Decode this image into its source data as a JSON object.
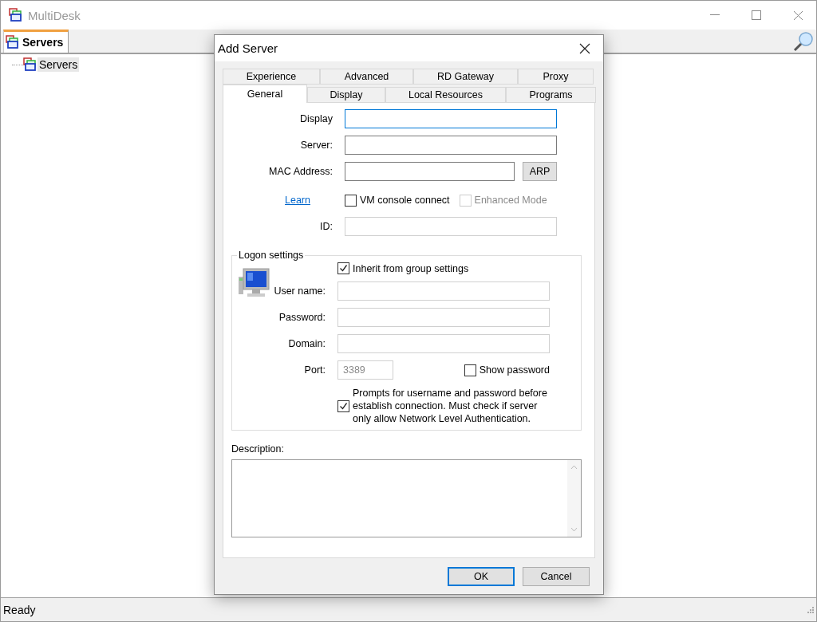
{
  "window": {
    "title": "MultiDesk"
  },
  "tabs": [
    {
      "label": "Servers",
      "selected": true
    }
  ],
  "tree": [
    {
      "label": "Servers",
      "selected": true
    }
  ],
  "status_bar": "Ready",
  "dialog": {
    "title": "Add Server",
    "tab_rows": [
      [
        {
          "label": "Experience",
          "selected": false
        },
        {
          "label": "Advanced",
          "selected": false
        },
        {
          "label": "RD Gateway",
          "selected": false
        },
        {
          "label": "Proxy",
          "selected": false
        }
      ],
      [
        {
          "label": "General",
          "selected": true
        },
        {
          "label": "Display",
          "selected": false
        },
        {
          "label": "Local Resources",
          "selected": false
        },
        {
          "label": "Programs",
          "selected": false
        }
      ]
    ],
    "display": {
      "label": "Display",
      "focused": true
    },
    "server": {
      "label": "Server:"
    },
    "mac": {
      "label": "MAC Address:",
      "button": "ARP"
    },
    "learn_link": "Learn",
    "vm_console": {
      "label": "VM console connect",
      "checked": false,
      "disabled": false
    },
    "enhanced_mode": {
      "label": "Enhanced Mode",
      "checked": false,
      "disabled": true
    },
    "id": {
      "label": "ID:",
      "disabled": true
    },
    "logon": {
      "title": "Logon settings",
      "inherit": {
        "label": "Inherit from group settings",
        "checked": true,
        "disabled": false
      },
      "fields": [
        {
          "label": "User name:",
          "disabled": true
        },
        {
          "label": "Password:",
          "disabled": true
        },
        {
          "label": "Domain:",
          "disabled": true
        }
      ],
      "port": {
        "label": "Port:",
        "value": "3389",
        "disabled": true
      },
      "show_password": {
        "label": "Show password",
        "checked": false,
        "disabled": false
      },
      "nla": {
        "label": "Prompts for username and password before establish connection. Must check if server only allow Network Level Authentication.",
        "checked": true,
        "disabled": false
      }
    },
    "description": {
      "label": "Description:"
    },
    "buttons": [
      {
        "label": "OK",
        "default": true
      },
      {
        "label": "Cancel",
        "default": false
      }
    ]
  }
}
